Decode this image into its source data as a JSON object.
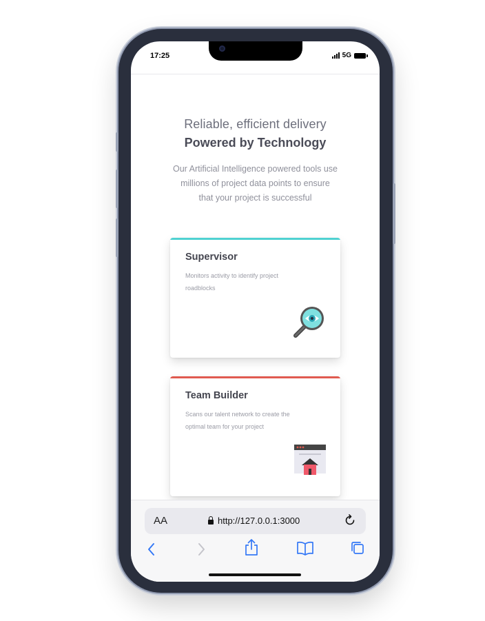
{
  "status_bar": {
    "time": "17:25",
    "network": "5G"
  },
  "hero": {
    "subtitle": "Reliable, efficient delivery",
    "title": "Powered by Technology",
    "description": "Our Artificial Intelligence powered tools use millions of project data points to ensure that your project is successful"
  },
  "cards": [
    {
      "title": "Supervisor",
      "text": "Monitors activity to identify project roadblocks",
      "accent": "#4fd1d1",
      "icon": "magnifier-eye-icon"
    },
    {
      "title": "Team Builder",
      "text": "Scans our talent network to create the optimal team for your project",
      "accent": "#e05a4f",
      "icon": "browser-house-icon"
    }
  ],
  "browser": {
    "text_size_label": "AA",
    "url": "http://127.0.0.1:3000",
    "toolbar": [
      "back-icon",
      "forward-icon",
      "share-icon",
      "bookmarks-icon",
      "tabs-icon"
    ]
  },
  "colors": {
    "accent_link": "#3478f6",
    "title_text": "#4a4b57"
  }
}
